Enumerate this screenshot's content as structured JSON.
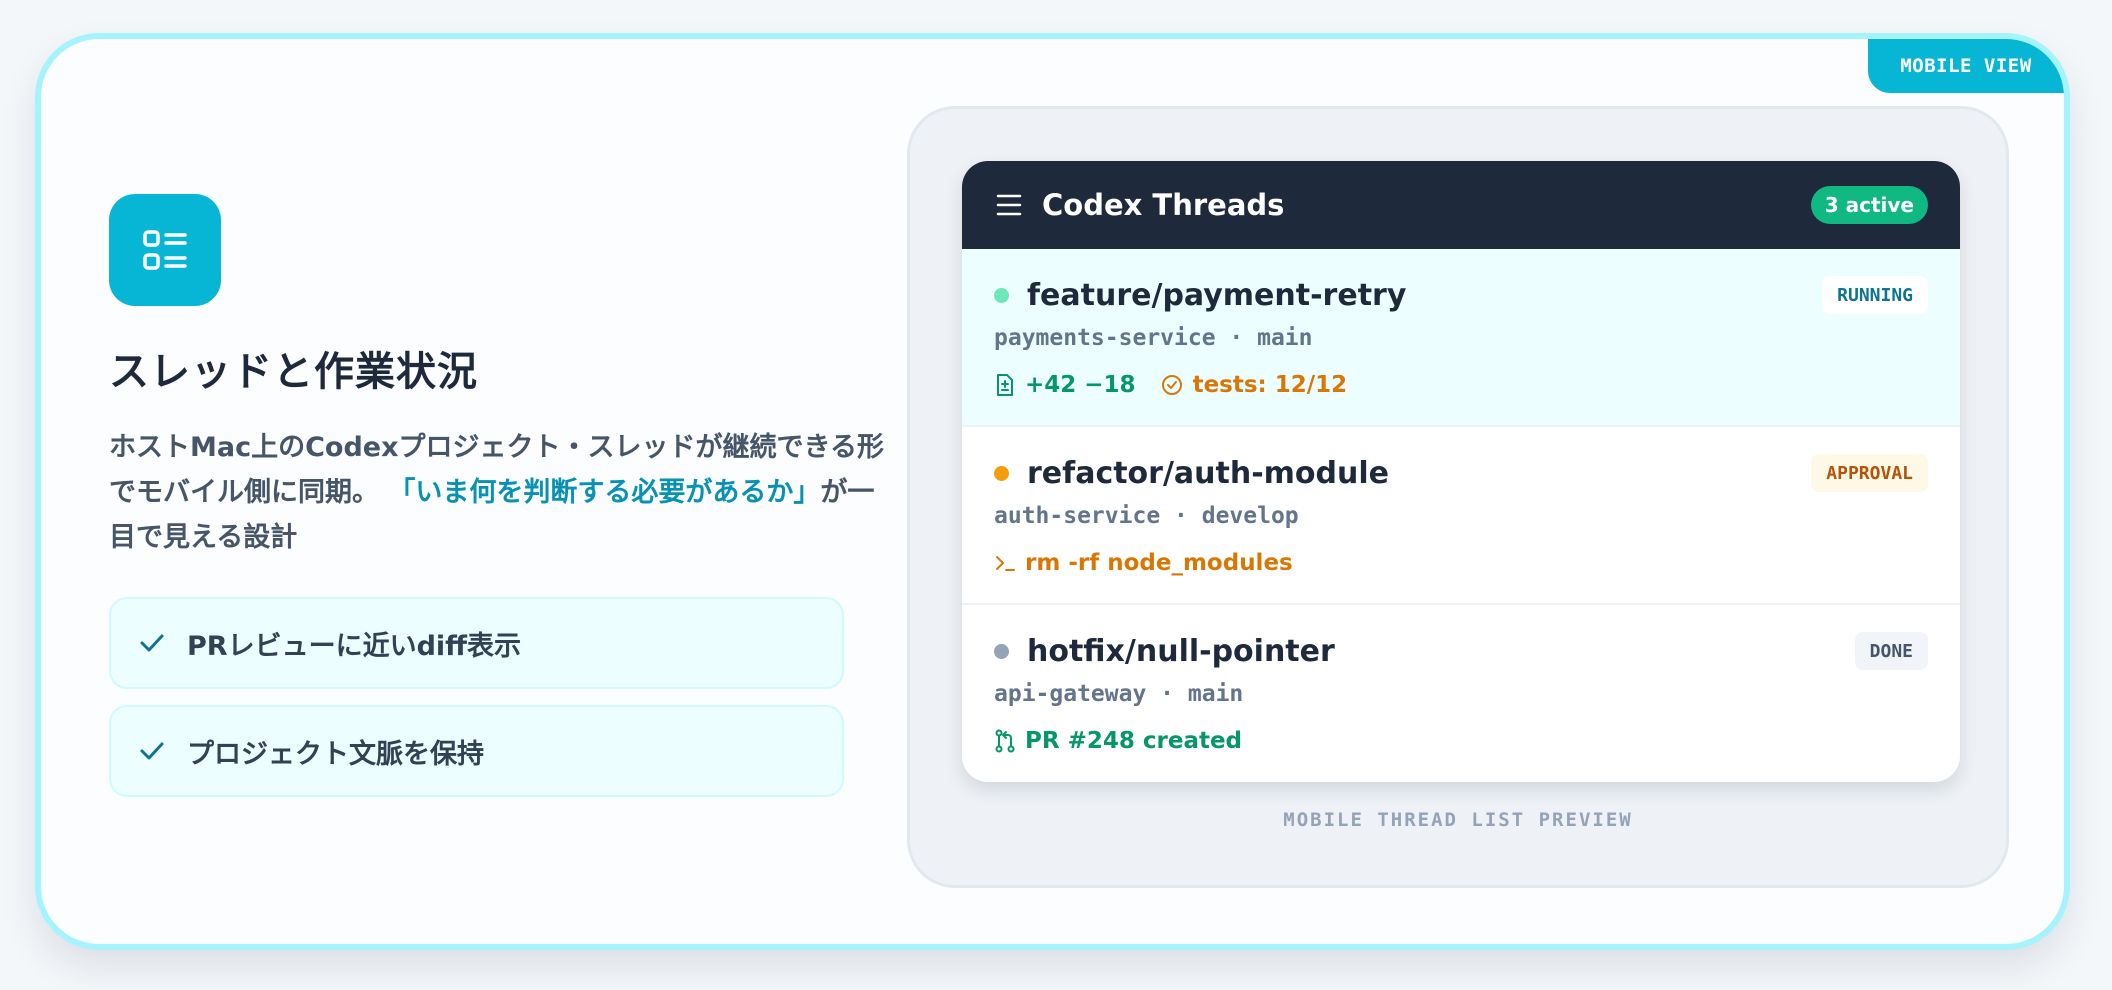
{
  "mobile_view_label": "MOBILE VIEW",
  "feature": {
    "icon": "list-layout-icon",
    "title": "スレッドと作業状況",
    "description_before": "ホストMac上のCodexプロジェクト・スレッドが継続できる形でモバイル側に同期。",
    "description_highlight": "「いま何を判断する必要があるか」",
    "description_after": "が一目で見える設計",
    "checklist": [
      {
        "label": "PRレビューに近いdiff表示"
      },
      {
        "label": "プロジェクト文脈を保持"
      }
    ]
  },
  "phone": {
    "title": "Codex Threads",
    "active_badge": "3 active",
    "threads": [
      {
        "name": "feature/payment-retry",
        "repo": "payments-service",
        "branch": "main",
        "status": "RUNNING",
        "diff": "+42 −18",
        "tests": "tests: 12/12"
      },
      {
        "name": "refactor/auth-module",
        "repo": "auth-service",
        "branch": "develop",
        "status": "APPROVAL",
        "command": "rm -rf node_modules"
      },
      {
        "name": "hotfix/null-pointer",
        "repo": "api-gateway",
        "branch": "main",
        "status": "DONE",
        "pr": "PR #248 created"
      }
    ]
  },
  "caption": "MOBILE THREAD LIST PREVIEW",
  "colors": {
    "accent": "#06b6d4",
    "running": "#34d399",
    "approval": "#f59e0b",
    "done": "#94a3b8",
    "success": "#059669",
    "warning": "#d97706"
  }
}
